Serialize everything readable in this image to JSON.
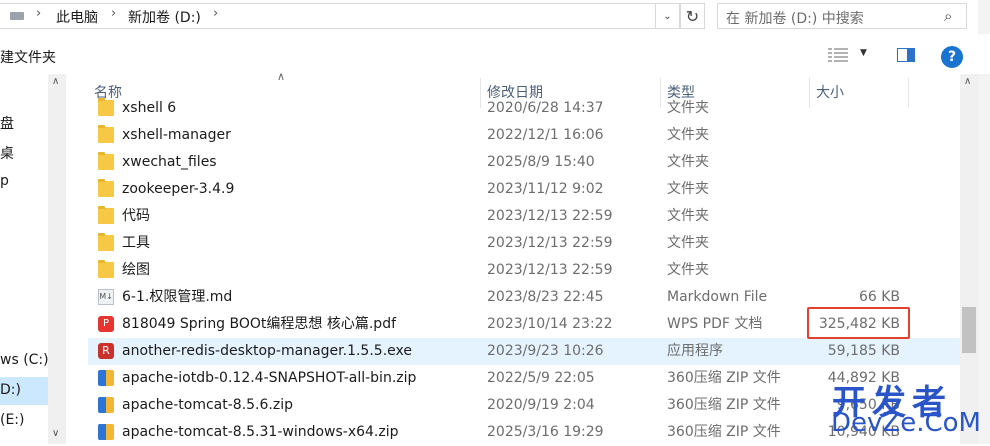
{
  "address": {
    "crumbs": [
      "此电脑",
      "新加卷 (D:)"
    ],
    "search_placeholder": "在 新加卷 (D:) 中搜索"
  },
  "toolbar": {
    "left_label": "建文件夹",
    "help_label": "?"
  },
  "nav": {
    "items": [
      {
        "label": "盘"
      },
      {
        "label": "桌"
      },
      {
        "label": "p"
      },
      {
        "label": "ws (C:)"
      },
      {
        "label": "D:)"
      },
      {
        "label": "(E:)"
      }
    ]
  },
  "columns": {
    "name": "名称",
    "date": "修改日期",
    "type": "类型",
    "size": "大小"
  },
  "files": [
    {
      "name": "xshell 6",
      "date": "2020/6/28 14:37",
      "type": "文件夹",
      "size": "",
      "icon": "folder-icon"
    },
    {
      "name": "xshell-manager",
      "date": "2022/12/1 16:06",
      "type": "文件夹",
      "size": "",
      "icon": "folder-icon"
    },
    {
      "name": "xwechat_files",
      "date": "2025/8/9 15:40",
      "type": "文件夹",
      "size": "",
      "icon": "folder-icon"
    },
    {
      "name": "zookeeper-3.4.9",
      "date": "2023/11/12 9:02",
      "type": "文件夹",
      "size": "",
      "icon": "folder-icon"
    },
    {
      "name": "代码",
      "date": "2023/12/13 22:59",
      "type": "文件夹",
      "size": "",
      "icon": "folder-icon"
    },
    {
      "name": "工具",
      "date": "2023/12/13 22:59",
      "type": "文件夹",
      "size": "",
      "icon": "folder-icon"
    },
    {
      "name": "绘图",
      "date": "2023/12/13 22:59",
      "type": "文件夹",
      "size": "",
      "icon": "folder-icon"
    },
    {
      "name": "6-1.权限管理.md",
      "date": "2023/8/23 22:45",
      "type": "Markdown File",
      "size": "66 KB",
      "icon": "markdown-icon"
    },
    {
      "name": "818049 Spring BOOt编程思想 核心篇.pdf",
      "date": "2023/10/14 23:22",
      "type": "WPS PDF 文档",
      "size": "325,482 KB",
      "icon": "pdf-icon"
    },
    {
      "name": "another-redis-desktop-manager.1.5.5.exe",
      "date": "2023/9/23 10:26",
      "type": "应用程序",
      "size": "59,185 KB",
      "icon": "redis-app-icon"
    },
    {
      "name": "apache-iotdb-0.12.4-SNAPSHOT-all-bin.zip",
      "date": "2022/5/9 22:05",
      "type": "360压缩 ZIP 文件",
      "size": "44,892 KB",
      "icon": "zip-icon"
    },
    {
      "name": "apache-tomcat-8.5.6.zip",
      "date": "2020/9/19 2:04",
      "type": "360压缩 ZIP 文件",
      "size": "9,650 KB",
      "icon": "zip-icon"
    },
    {
      "name": "apache-tomcat-8.5.31-windows-x64.zip",
      "date": "2025/3/16 19:29",
      "type": "360压缩 ZIP 文件",
      "size": "10,940 KB",
      "icon": "zip-icon"
    }
  ],
  "watermark": {
    "line1": "开发者",
    "line2": "DevZe.CoM"
  },
  "colors": {
    "selection": "#e5f3ff",
    "highlight_box": "#e3412f",
    "help_blue": "#1874d0"
  }
}
